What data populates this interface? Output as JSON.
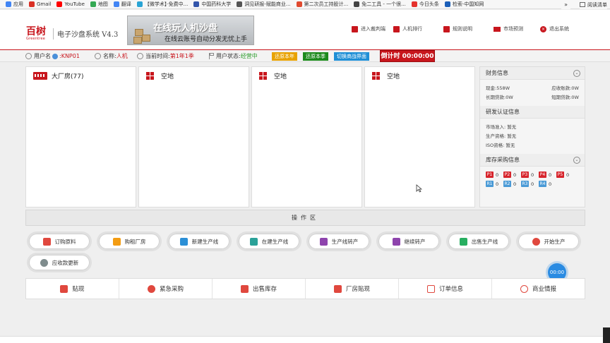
{
  "bookmarks": [
    {
      "label": "应用",
      "icon": "apps-icon",
      "color": "#4285f4"
    },
    {
      "label": "Gmail",
      "icon": "gmail-icon",
      "color": "#d93025"
    },
    {
      "label": "YouTube",
      "icon": "youtube-icon",
      "color": "#ff0000"
    },
    {
      "label": "地图",
      "icon": "maps-icon",
      "color": "#34a853"
    },
    {
      "label": "翻译",
      "icon": "translate-icon",
      "color": "#4285f4"
    },
    {
      "label": "【微学术】·免费中...",
      "icon": "bookmark-icon",
      "color": "#2aa4d5"
    },
    {
      "label": "中国药科大学",
      "icon": "university-icon",
      "color": "#3355aa"
    },
    {
      "label": "洞见研报-赋能商业...",
      "icon": "report-icon",
      "color": "#555555"
    },
    {
      "label": "第二次员工持股计...",
      "icon": "doc-icon",
      "color": "#e04a2f"
    },
    {
      "label": "免二工具 - 一个很...",
      "icon": "tool-icon",
      "color": "#444444"
    },
    {
      "label": "今日头条",
      "icon": "news-icon",
      "color": "#e5322d"
    },
    {
      "label": "检索-中国知网",
      "icon": "search-icon",
      "color": "#1c5fb8"
    }
  ],
  "bookmarks_more": "»",
  "reading_list": "阅读清单",
  "header": {
    "logo_text": "百树",
    "logo_sub": "Greentree",
    "title": "电子沙盘系统 V4.3",
    "banner_line1": "在线玩人机沙盘",
    "banner_line2": "在线云账号自动分发无忧上手",
    "nav": [
      {
        "label": "进入裁判端",
        "icon": "referee-icon"
      },
      {
        "label": "人机排行",
        "icon": "ranking-icon"
      },
      {
        "label": "规则说明",
        "icon": "rules-icon"
      },
      {
        "label": "市场预测",
        "icon": "mail-icon"
      },
      {
        "label": "退出系统",
        "icon": "exit-icon"
      }
    ]
  },
  "status": {
    "username_label": "用户名",
    "username_value": ":KNP01",
    "name_label": "名称:",
    "name_value": "人机",
    "time_label": "当前时间:",
    "time_value": "第1年1季",
    "state_label": "用户状态:",
    "state_value": "经营中",
    "btn_year": "还原本年",
    "btn_season": "还原本季",
    "btn_switch": "切换商战界面",
    "countdown": "倒计时 00:00:00"
  },
  "factories": [
    {
      "title": "大厂房(77)",
      "type": "factory"
    },
    {
      "title": "空地",
      "type": "empty"
    },
    {
      "title": "空地",
      "type": "empty"
    },
    {
      "title": "空地",
      "type": "empty"
    }
  ],
  "info": {
    "finance": {
      "title": "财务信息",
      "cash": "现金:558W",
      "receivable": "应收账款:0W",
      "long_loan": "长期贷款:0W",
      "short_loan": "短期贷款:0W"
    },
    "rnd": {
      "title": "研发认证信息",
      "market": "市场准入: 暂无",
      "production": "生产资格: 暂无",
      "iso": "ISO资格: 暂无"
    },
    "stock": {
      "title": "库存采购信息",
      "products": [
        {
          "code": "P1",
          "qty": "0"
        },
        {
          "code": "P2",
          "qty": "0"
        },
        {
          "code": "P3",
          "qty": "0"
        },
        {
          "code": "P4",
          "qty": "0"
        },
        {
          "code": "P5",
          "qty": "0"
        }
      ],
      "materials": [
        {
          "code": "R1",
          "qty": "0"
        },
        {
          "code": "R2",
          "qty": "0"
        },
        {
          "code": "R3",
          "qty": "0"
        },
        {
          "code": "R4",
          "qty": "0"
        }
      ]
    }
  },
  "op_zone": "操作区",
  "op_buttons": [
    {
      "label": "订购原料",
      "icon": "calendar-icon",
      "color": "#e0483e"
    },
    {
      "label": "购租厂房",
      "icon": "house-icon",
      "color": "#f39c12"
    },
    {
      "label": "新建生产线",
      "icon": "walker-icon",
      "color": "#2b8fd6"
    },
    {
      "label": "在建生产线",
      "icon": "construction-icon",
      "color": "#2aa198"
    },
    {
      "label": "生产线转产",
      "icon": "runner-icon",
      "color": "#8e44ad"
    },
    {
      "label": "继续转产",
      "icon": "runner-icon",
      "color": "#8e44ad"
    },
    {
      "label": "出售生产线",
      "icon": "sell-icon",
      "color": "#27ae60"
    },
    {
      "label": "开始生产",
      "icon": "start-icon",
      "color": "#e0483e"
    },
    {
      "label": "应收款更新",
      "icon": "refresh-icon",
      "color": "#7f8c8d"
    }
  ],
  "bottom_tabs": [
    {
      "label": "贴现",
      "icon": "discount-icon",
      "color": "#e0483e"
    },
    {
      "label": "紧急采购",
      "icon": "urgent-icon",
      "color": "#e0483e"
    },
    {
      "label": "出售库存",
      "icon": "inventory-icon",
      "color": "#e0483e"
    },
    {
      "label": "厂房贴现",
      "icon": "factory-discount-icon",
      "color": "#e0483e"
    },
    {
      "label": "订单信息",
      "icon": "order-icon",
      "color": "#e0483e"
    },
    {
      "label": "商业情报",
      "icon": "intel-icon",
      "color": "#e0483e"
    }
  ],
  "timer_bubble": "00:00",
  "colors": {
    "brand": "#c8161d"
  }
}
